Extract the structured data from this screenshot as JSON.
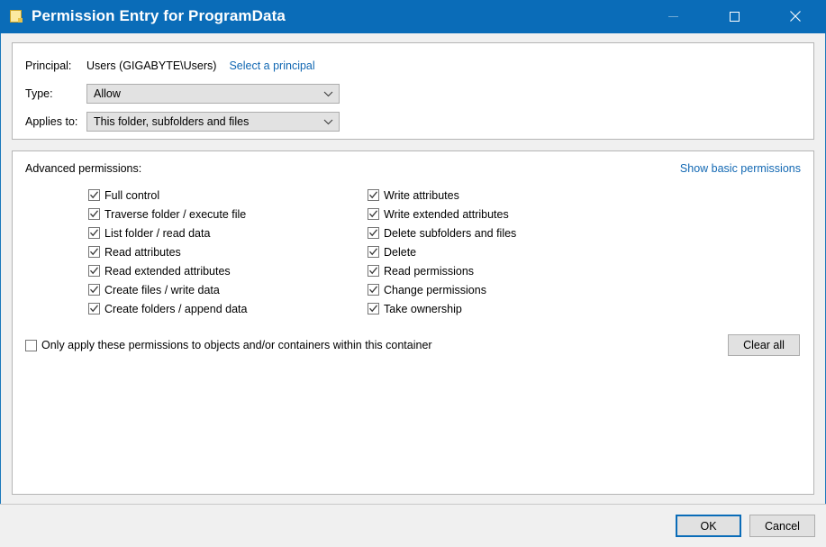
{
  "window": {
    "title": "Permission Entry for ProgramData",
    "icon": "folder-icon",
    "controls": {
      "minimize_label": "Minimize",
      "maximize_label": "Maximize",
      "close_label": "Close"
    }
  },
  "principal_panel": {
    "principal_label": "Principal:",
    "principal_value": "Users (GIGABYTE\\Users)",
    "select_principal_link": "Select a principal",
    "type_label": "Type:",
    "type_value": "Allow",
    "applies_to_label": "Applies to:",
    "applies_to_value": "This folder, subfolders and files"
  },
  "permissions_panel": {
    "heading": "Advanced permissions:",
    "toggle_link": "Show basic permissions",
    "left_column": [
      {
        "label": "Full control",
        "checked": true
      },
      {
        "label": "Traverse folder / execute file",
        "checked": true
      },
      {
        "label": "List folder / read data",
        "checked": true
      },
      {
        "label": "Read attributes",
        "checked": true
      },
      {
        "label": "Read extended attributes",
        "checked": true
      },
      {
        "label": "Create files / write data",
        "checked": true
      },
      {
        "label": "Create folders / append data",
        "checked": true
      }
    ],
    "right_column": [
      {
        "label": "Write attributes",
        "checked": true
      },
      {
        "label": "Write extended attributes",
        "checked": true
      },
      {
        "label": "Delete subfolders and files",
        "checked": true
      },
      {
        "label": "Delete",
        "checked": true
      },
      {
        "label": "Read permissions",
        "checked": true
      },
      {
        "label": "Change permissions",
        "checked": true
      },
      {
        "label": "Take ownership",
        "checked": true
      }
    ],
    "only_apply_label": "Only apply these permissions to objects and/or containers within this container",
    "only_apply_checked": false,
    "clear_all_label": "Clear all"
  },
  "footer": {
    "ok_label": "OK",
    "cancel_label": "Cancel"
  },
  "colors": {
    "titlebar": "#0a6cb8",
    "link": "#1268b3",
    "dialog_bg": "#f0f0f0",
    "panel_bg": "#ffffff",
    "control_bg": "#e1e1e1",
    "border": "#b5b5b5",
    "focus_border": "#0a6cb8"
  }
}
